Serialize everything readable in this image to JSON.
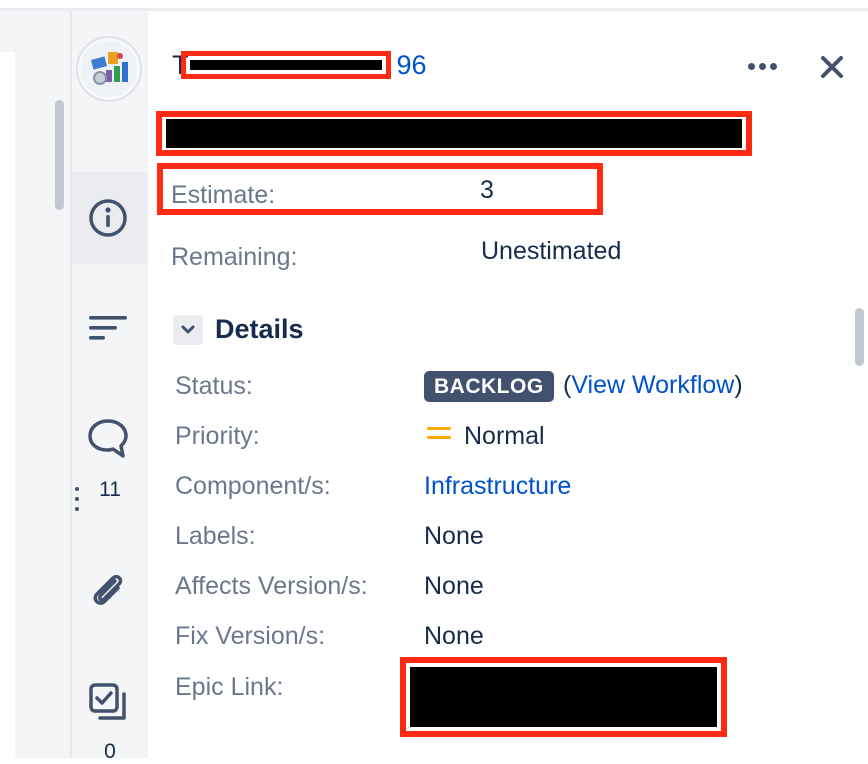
{
  "header": {
    "title_prefix": "T",
    "title_suffix": "96"
  },
  "summary": {
    "estimate_label": "Estimate:",
    "estimate_value": "3",
    "remaining_label": "Remaining:",
    "remaining_value": "Unestimated"
  },
  "rail": {
    "comments_count": "11",
    "checklist_count": "0"
  },
  "details": {
    "title": "Details",
    "status": {
      "label": "Status:",
      "value": "BACKLOG",
      "workflow_open": "(",
      "workflow_link": "View Workflow",
      "workflow_close": ")"
    },
    "priority": {
      "label": "Priority:",
      "value": "Normal",
      "icon": "priority-medium-icon"
    },
    "components": {
      "label": "Component/s:",
      "value": "Infrastructure"
    },
    "labels": {
      "label": "Labels:",
      "value": "None"
    },
    "affects_versions": {
      "label": "Affects Version/s:",
      "value": "None"
    },
    "fix_versions": {
      "label": "Fix Version/s:",
      "value": "None"
    },
    "epic_link": {
      "label": "Epic Link:"
    }
  },
  "colors": {
    "link": "#0052cc",
    "text": "#172b4d",
    "muted": "#6b778c",
    "lozenge_bg": "#42526e",
    "priority": "#ffab00",
    "redaction_outline": "#ff2a12"
  }
}
